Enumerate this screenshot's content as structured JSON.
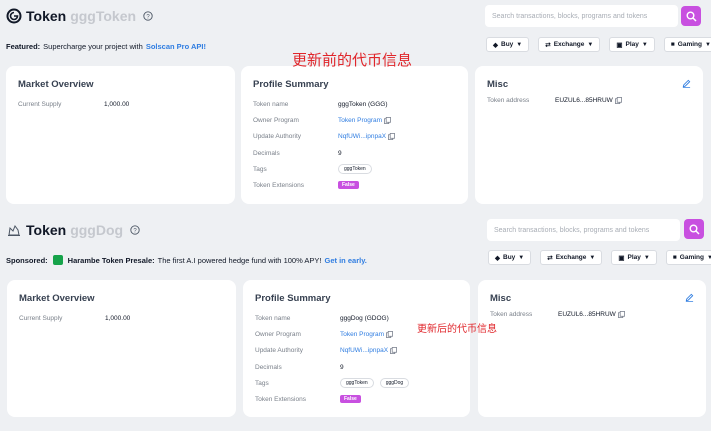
{
  "before": {
    "title_label": "Token",
    "title_name": "gggToken",
    "search": {
      "placeholder": "Search transactions, blocks, programs and tokens"
    },
    "featured": {
      "key": "Featured:",
      "text": "Supercharge your project with",
      "link": "Solscan Pro API!"
    },
    "nav": [
      {
        "label": "Buy",
        "icon": "coin-icon"
      },
      {
        "label": "Exchange",
        "icon": "exchange-icon"
      },
      {
        "label": "Play",
        "icon": "play-icon"
      },
      {
        "label": "Gaming",
        "icon": "gamepad-icon"
      }
    ],
    "market": {
      "title": "Market Overview",
      "supply_label": "Current Supply",
      "supply_value": "1,000.00"
    },
    "profile": {
      "title": "Profile Summary",
      "rows": {
        "token_name": {
          "label": "Token name",
          "value": "gggToken (GGG)"
        },
        "owner_program": {
          "label": "Owner Program",
          "value": "Token Program"
        },
        "update_authority": {
          "label": "Update Authority",
          "value": "NqfUWi...ipnpaX"
        },
        "decimals": {
          "label": "Decimals",
          "value": "9"
        },
        "tags": {
          "label": "Tags",
          "values": [
            "gggToken"
          ]
        },
        "extensions": {
          "label": "Token Extensions",
          "value": "False"
        }
      }
    },
    "misc": {
      "title": "Misc",
      "address_label": "Token address",
      "address_value": "EUZUL6...85HRUW"
    }
  },
  "after": {
    "title_label": "Token",
    "title_name": "gggDog",
    "search": {
      "placeholder": "Search transactions, blocks, programs and tokens"
    },
    "sponsored": {
      "key": "Sponsored:",
      "name": "Harambe Token Presale:",
      "text": "The first A.I powered hedge fund with 100% APY!",
      "link": "Get in early."
    },
    "nav": [
      {
        "label": "Buy",
        "icon": "coin-icon"
      },
      {
        "label": "Exchange",
        "icon": "exchange-icon"
      },
      {
        "label": "Play",
        "icon": "play-icon"
      },
      {
        "label": "Gaming",
        "icon": "gamepad-icon"
      }
    ],
    "market": {
      "title": "Market Overview",
      "supply_label": "Current Supply",
      "supply_value": "1,000.00"
    },
    "profile": {
      "title": "Profile Summary",
      "rows": {
        "token_name": {
          "label": "Token name",
          "value": "gggDog (GDOG)"
        },
        "owner_program": {
          "label": "Owner Program",
          "value": "Token Program"
        },
        "update_authority": {
          "label": "Update Authority",
          "value": "NqfUWi...ipnpaX"
        },
        "decimals": {
          "label": "Decimals",
          "value": "9"
        },
        "tags": {
          "label": "Tags",
          "values": [
            "gggToken",
            "gggDog"
          ]
        },
        "extensions": {
          "label": "Token Extensions",
          "value": "False"
        }
      }
    },
    "misc": {
      "title": "Misc",
      "address_label": "Token address",
      "address_value": "EUZUL6...85HRUW"
    }
  },
  "annotations": {
    "before": "更新前的代币信息",
    "after": "更新后的代币信息"
  },
  "colors": {
    "accent": "#c850e0",
    "link": "#2f7de1",
    "annotation": "#e0262b",
    "background": "#eef0f3"
  }
}
